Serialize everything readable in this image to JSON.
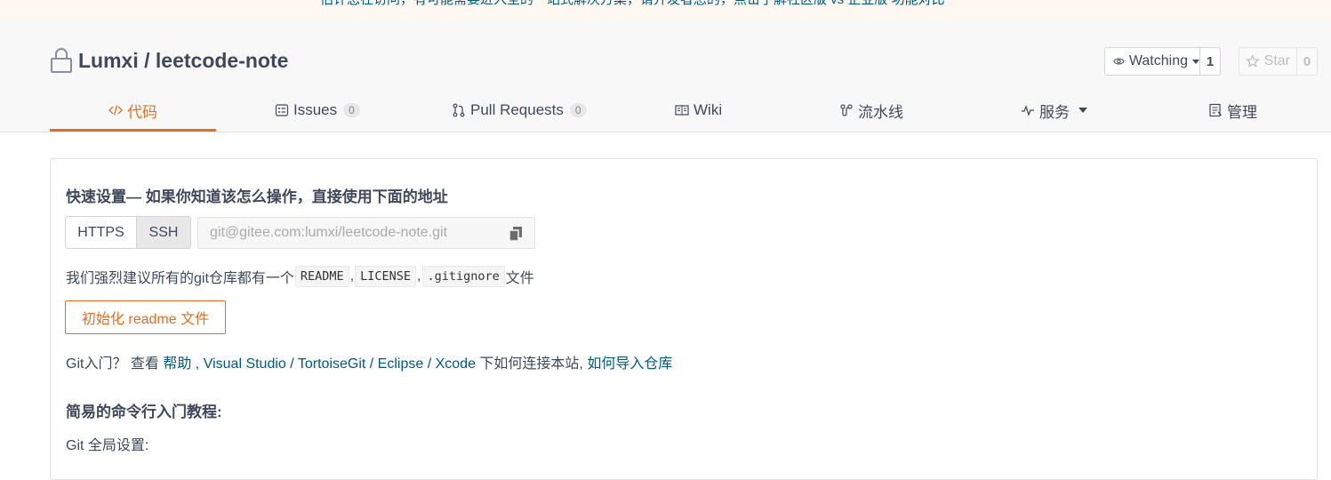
{
  "notice": {
    "text": "估计您在访问，有可能需要进入全的一站式解决方案，请开发者您的，点击了解社区版 vs 企业版 功能对比"
  },
  "repo": {
    "name": "Lumxi / leetcode-note"
  },
  "watch": {
    "label": "Watching",
    "count": "1"
  },
  "star": {
    "label": "Star",
    "count": "0"
  },
  "tabs": [
    {
      "label": "代码",
      "icon": "code-icon",
      "active": true
    },
    {
      "label": "Issues",
      "badge": "0",
      "icon": "issues-icon"
    },
    {
      "label": "Pull Requests",
      "badge": "0",
      "icon": "pull-request-icon"
    },
    {
      "label": "Wiki",
      "icon": "wiki-icon"
    },
    {
      "label": "流水线",
      "icon": "pipeline-icon"
    },
    {
      "label": "服务",
      "icon": "pulse-icon"
    },
    {
      "label": "管理",
      "icon": "manage-icon"
    }
  ],
  "quick_setup": {
    "title": "快速设置— 如果你知道该怎么操作，直接使用下面的地址",
    "https_label": "HTTPS",
    "ssh_label": "SSH",
    "url": "git@gitee.com:lumxi/leetcode-note.git"
  },
  "suggest": {
    "prefix": "我们强烈建议所有的git仓库都有一个",
    "file1": "README",
    "sep1": ",",
    "file2": "LICENSE",
    "sep2": ",",
    "file3": ".gitignore",
    "suffix": "文件"
  },
  "init_button": "初始化 readme 文件",
  "help": {
    "prefix": "Git入门？ 查看 ",
    "link_help": "帮助",
    "sep1": " , ",
    "link_vs": "Visual Studio",
    "sep2": " / ",
    "link_tgit": "TortoiseGit",
    "sep3": " / ",
    "link_eclipse": "Eclipse",
    "sep4": " / ",
    "link_xcode": "Xcode",
    "mid": " 下如何连接本站, ",
    "link_import": "如何导入仓库"
  },
  "cli": {
    "title": "简易的命令行入门教程:",
    "global": "Git 全局设置:"
  },
  "colors": {
    "accent": "#e07025",
    "link": "#005980",
    "text": "#40485b"
  }
}
